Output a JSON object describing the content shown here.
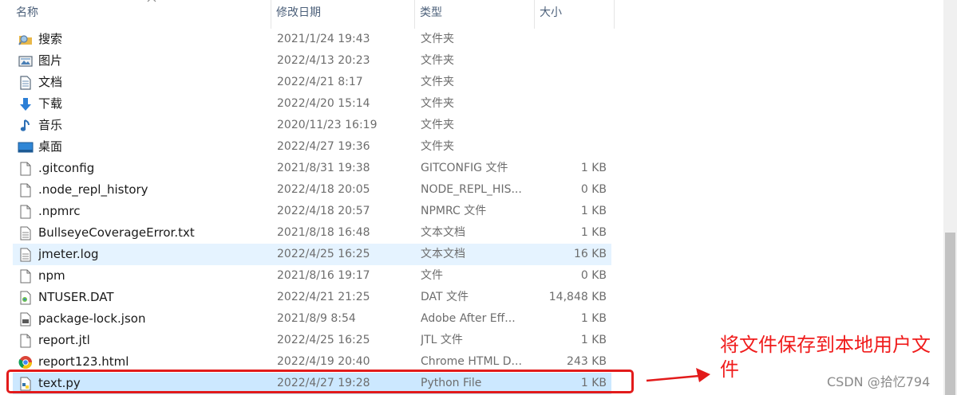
{
  "columns": {
    "name": "名称",
    "date": "修改日期",
    "type": "类型",
    "size": "大小"
  },
  "rows": [
    {
      "icon": "search-folder-icon",
      "name": "搜索",
      "date": "2021/1/24 19:43",
      "type": "文件夹",
      "size": ""
    },
    {
      "icon": "pictures-folder-icon",
      "name": "图片",
      "date": "2022/4/13 20:23",
      "type": "文件夹",
      "size": ""
    },
    {
      "icon": "documents-folder-icon",
      "name": "文档",
      "date": "2022/4/21 8:17",
      "type": "文件夹",
      "size": ""
    },
    {
      "icon": "download-folder-icon",
      "name": "下载",
      "date": "2022/4/20 15:14",
      "type": "文件夹",
      "size": ""
    },
    {
      "icon": "music-folder-icon",
      "name": "音乐",
      "date": "2020/11/23 16:19",
      "type": "文件夹",
      "size": ""
    },
    {
      "icon": "desktop-folder-icon",
      "name": "桌面",
      "date": "2022/4/27 19:36",
      "type": "文件夹",
      "size": ""
    },
    {
      "icon": "file-icon",
      "name": ".gitconfig",
      "date": "2021/8/31 19:38",
      "type": "GITCONFIG 文件",
      "size": "1 KB"
    },
    {
      "icon": "file-icon",
      "name": ".node_repl_history",
      "date": "2022/4/18 20:05",
      "type": "NODE_REPL_HIS...",
      "size": "0 KB"
    },
    {
      "icon": "file-icon",
      "name": ".npmrc",
      "date": "2022/4/18 20:57",
      "type": "NPMRC 文件",
      "size": "1 KB"
    },
    {
      "icon": "text-file-icon",
      "name": "BullseyeCoverageError.txt",
      "date": "2021/8/18 16:48",
      "type": "文本文档",
      "size": "1 KB"
    },
    {
      "icon": "text-file-icon",
      "name": "jmeter.log",
      "date": "2022/4/25 16:25",
      "type": "文本文档",
      "size": "16 KB"
    },
    {
      "icon": "file-icon",
      "name": "npm",
      "date": "2021/8/16 19:17",
      "type": "文件",
      "size": "0 KB"
    },
    {
      "icon": "dat-file-icon",
      "name": "NTUSER.DAT",
      "date": "2022/4/21 21:25",
      "type": "DAT 文件",
      "size": "14,848 KB"
    },
    {
      "icon": "json-file-icon",
      "name": "package-lock.json",
      "date": "2021/8/9 8:54",
      "type": "Adobe After Eff...",
      "size": "1 KB"
    },
    {
      "icon": "file-icon",
      "name": "report.jtl",
      "date": "2022/4/25 16:25",
      "type": "JTL 文件",
      "size": "1 KB"
    },
    {
      "icon": "chrome-icon",
      "name": "report123.html",
      "date": "2022/4/19 20:40",
      "type": "Chrome HTML D...",
      "size": "243 KB"
    },
    {
      "icon": "python-file-icon",
      "name": "text.py",
      "date": "2022/4/27 19:28",
      "type": "Python File",
      "size": "1 KB"
    }
  ],
  "annotation": {
    "text": "将文件保存到本地用户文件",
    "color": "#f01c1c"
  },
  "watermark": "CSDN @拾忆794",
  "colors": {
    "selected_row": "#e5f3ff",
    "highlighted_row": "#cce8ff",
    "annotation_red": "#e21b1b"
  }
}
